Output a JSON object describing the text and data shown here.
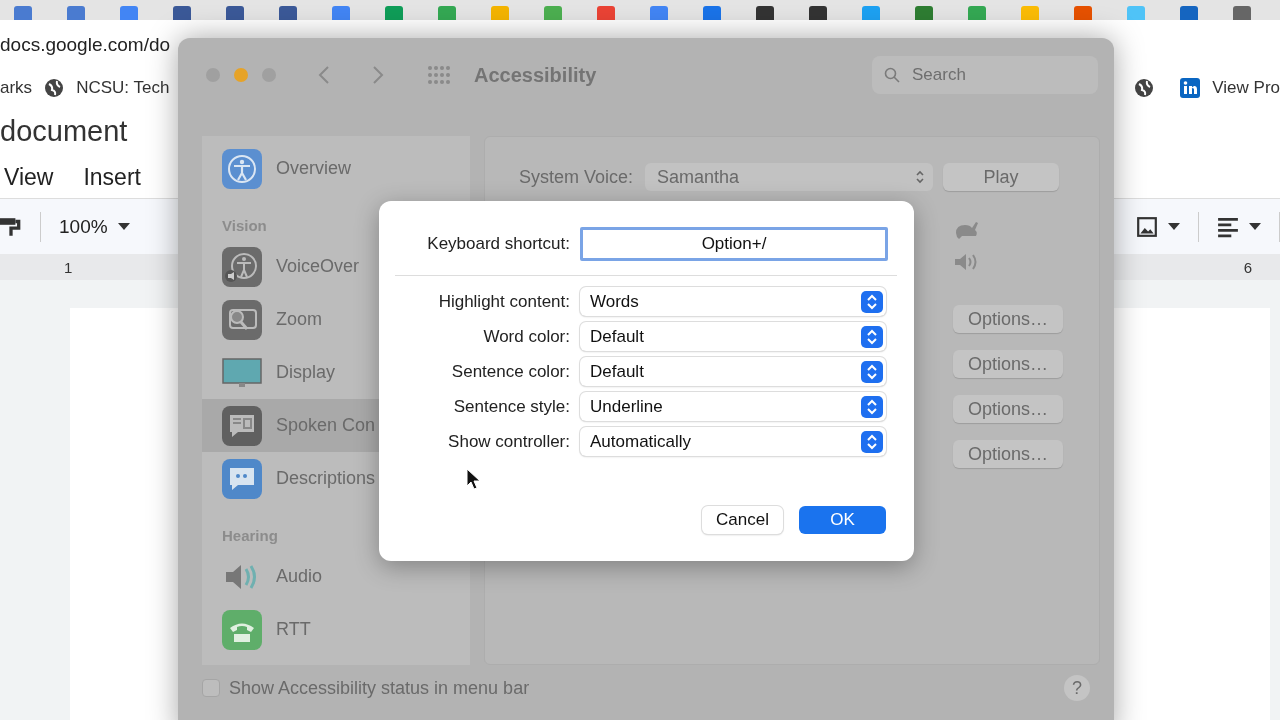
{
  "browser": {
    "address": "docs.google.com/do",
    "bookmarks_left": [
      "arks",
      "NCSU: Tech"
    ],
    "bookmarks_right": [
      "View Pro"
    ],
    "doc_title": "document",
    "menu": [
      "View",
      "Insert"
    ],
    "zoom": "100%",
    "ruler": [
      "1",
      "6"
    ]
  },
  "prefs_window": {
    "title": "Accessibility",
    "search": {
      "placeholder": "Search"
    },
    "sidebar": [
      {
        "kind": "item",
        "label": "Overview",
        "selected": false
      },
      {
        "kind": "header",
        "label": "Vision"
      },
      {
        "kind": "item",
        "label": "VoiceOver",
        "selected": false
      },
      {
        "kind": "item",
        "label": "Zoom",
        "selected": false
      },
      {
        "kind": "item",
        "label": "Display",
        "selected": false
      },
      {
        "kind": "item",
        "label": "Spoken Con",
        "selected": true
      },
      {
        "kind": "item",
        "label": "Descriptions",
        "selected": false
      },
      {
        "kind": "header",
        "label": "Hearing"
      },
      {
        "kind": "item",
        "label": "Audio",
        "selected": false
      },
      {
        "kind": "item",
        "label": "RTT",
        "selected": false
      }
    ],
    "system_voice_label": "System Voice:",
    "system_voice": "Samantha",
    "play": "Play",
    "options_buttons": [
      "Options…",
      "Options…",
      "Options…",
      "Options…"
    ],
    "status_checkbox": {
      "label": "Show Accessibility status in menu bar",
      "checked": false
    },
    "help": "?"
  },
  "dialog": {
    "shortcut_label": "Keyboard shortcut:",
    "shortcut_value": "Option+/",
    "rows": [
      {
        "label": "Highlight content:",
        "value": "Words"
      },
      {
        "label": "Word color:",
        "value": "Default"
      },
      {
        "label": "Sentence color:",
        "value": "Default"
      },
      {
        "label": "Sentence style:",
        "value": "Underline"
      },
      {
        "label": "Show controller:",
        "value": "Automatically"
      }
    ],
    "buttons": [
      {
        "label": "Cancel",
        "kind": "normal"
      },
      {
        "label": "OK",
        "kind": "default"
      }
    ]
  }
}
